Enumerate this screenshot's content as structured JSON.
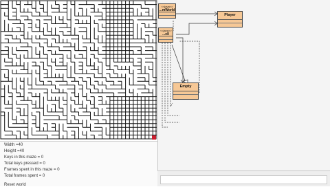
{
  "info": {
    "width": "Width =40",
    "height": "Height =40",
    "keys": "Keys in this maze = 0",
    "total_keys": "Total keys pressed = 0",
    "frames": "Frames spent in this maze = 0",
    "total_frames": "Total frames spent = 0",
    "reset": "Reset world"
  },
  "classes": {
    "world_stereo": "<<java>>",
    "world_name": "...mWorld",
    "player_name": "Player",
    "cell_stereo": "<<java>>",
    "cell_name": "...ell",
    "empty_name": "Empty"
  },
  "colors": {
    "class_fill": "#f6c896",
    "goal": "#cc1f2f"
  }
}
